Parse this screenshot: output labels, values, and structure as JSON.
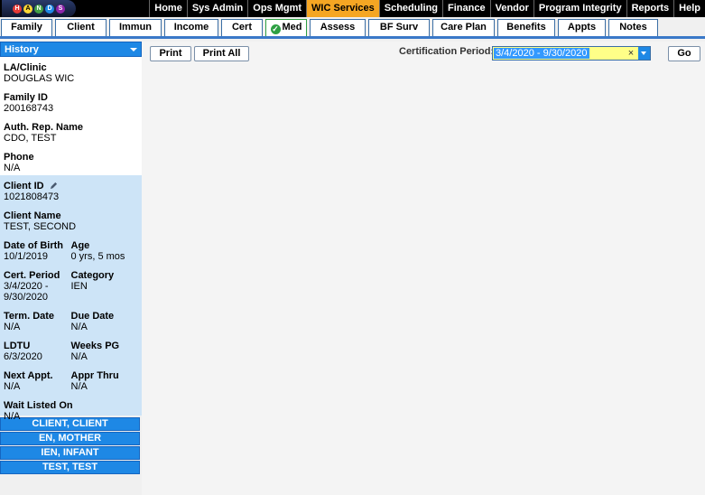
{
  "topnav": [
    "Home",
    "Sys Admin",
    "Ops Mgmt",
    "WIC Services",
    "Scheduling",
    "Finance",
    "Vendor",
    "Program Integrity",
    "Reports",
    "Help"
  ],
  "subnav": [
    "Family",
    "Client",
    "Immun",
    "Income",
    "Cert",
    "Med",
    "Assess",
    "BF Surv",
    "Care Plan",
    "Benefits",
    "Appts",
    "Notes"
  ],
  "history": "History",
  "family": {
    "la_clinic_label": "LA/Clinic",
    "la_clinic": "DOUGLAS WIC",
    "family_id_label": "Family ID",
    "family_id": "200168743",
    "auth_rep_label": "Auth. Rep. Name",
    "auth_rep": "CDO, TEST",
    "phone_label": "Phone",
    "phone": "N/A"
  },
  "client": {
    "client_id_label": "Client ID",
    "client_id": "1021808473",
    "client_name_label": "Client Name",
    "client_name": "TEST, SECOND",
    "dob_label": "Date of Birth",
    "dob": "10/1/2019",
    "age_label": "Age",
    "age": "0 yrs, 5 mos",
    "cert_period_label": "Cert. Period",
    "cert_period_1": "3/4/2020 -",
    "cert_period_2": "9/30/2020",
    "category_label": "Category",
    "category": "IEN",
    "term_date_label": "Term. Date",
    "term_date": "N/A",
    "due_date_label": "Due Date",
    "due_date": "N/A",
    "ldtu_label": "LDTU",
    "ldtu": "6/3/2020",
    "weeks_pg_label": "Weeks PG",
    "weeks_pg": "N/A",
    "next_appt_label": "Next Appt.",
    "next_appt": "N/A",
    "appr_thru_label": "Appr Thru",
    "appr_thru": "N/A",
    "wait_listed_label": "Wait Listed On",
    "wait_listed": "N/A"
  },
  "family_clients": [
    "CLIENT, CLIENT",
    "EN, MOTHER",
    "IEN, INFANT",
    "TEST, TEST"
  ],
  "toolbar": {
    "print": "Print",
    "print_all": "Print All",
    "cert_period_label": "Certification Period:",
    "cert_period_value": "3/4/2020 - 9/30/2020",
    "clear": "×",
    "go": "Go"
  },
  "logo_letters": [
    "H",
    "A",
    "N",
    "D",
    "S"
  ],
  "colors": {
    "accent": "#1e88e5",
    "active_tab": "#f5a623",
    "client_panel": "#cde4f7"
  }
}
